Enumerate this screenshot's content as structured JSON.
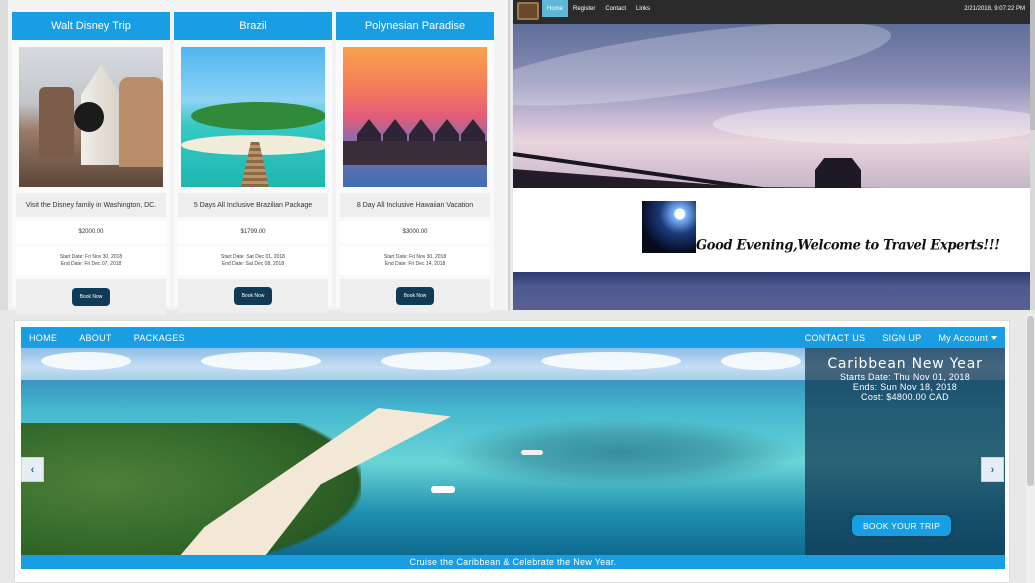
{
  "packages": [
    {
      "title": "Walt Disney Trip",
      "description": "Visit the Disney family in Washington, DC.",
      "price": "$2000.00",
      "start": "Start Date: Fri Nov 30, 2018",
      "end": "End Date: Fri Dec 07, 2018",
      "button": "Book Now"
    },
    {
      "title": "Brazil",
      "description": "5 Days All Inclusive Brazilian Package",
      "price": "$1799.00",
      "start": "Start Date: Sat Dec 01, 2018",
      "end": "End Date: Sat Dec 08, 2018",
      "button": "Book Now"
    },
    {
      "title": "Polynesian Paradise",
      "description": "8 Day All Inclusive Hawaiian Vacation",
      "price": "$3000.00",
      "start": "Start Date: Fri Nov 30, 2018",
      "end": "End Date: Fri Dec 14, 2018",
      "button": "Book Now"
    }
  ],
  "travel_experts": {
    "nav": [
      "Home",
      "Register",
      "Contact",
      "Links"
    ],
    "active_nav": "Home",
    "clock": "2/21/2018, 9:07:22 PM",
    "welcome": "Good Evening,Welcome to Travel Experts!!!"
  },
  "caribbean_site": {
    "nav_left": [
      "HOME",
      "ABOUT",
      "PACKAGES"
    ],
    "nav_right": [
      "CONTACT US",
      "SIGN UP",
      "My Account"
    ],
    "slide": {
      "title": "Caribbean New Year",
      "start": "Starts Date: Thu Nov 01, 2018",
      "end": "Ends: Sun Nov 18, 2018",
      "cost": "Cost: $4800.00 CAD",
      "button": "BOOK YOUR TRIP",
      "caption": "Cruise the Caribbean & Celebrate the New Year."
    },
    "prev_icon": "‹",
    "next_icon": "›"
  },
  "colors": {
    "accent": "#1a9ee3",
    "book_button": "#0f3b57",
    "topbar": "#2b2b2b",
    "active_tab": "#5eb6d8"
  }
}
